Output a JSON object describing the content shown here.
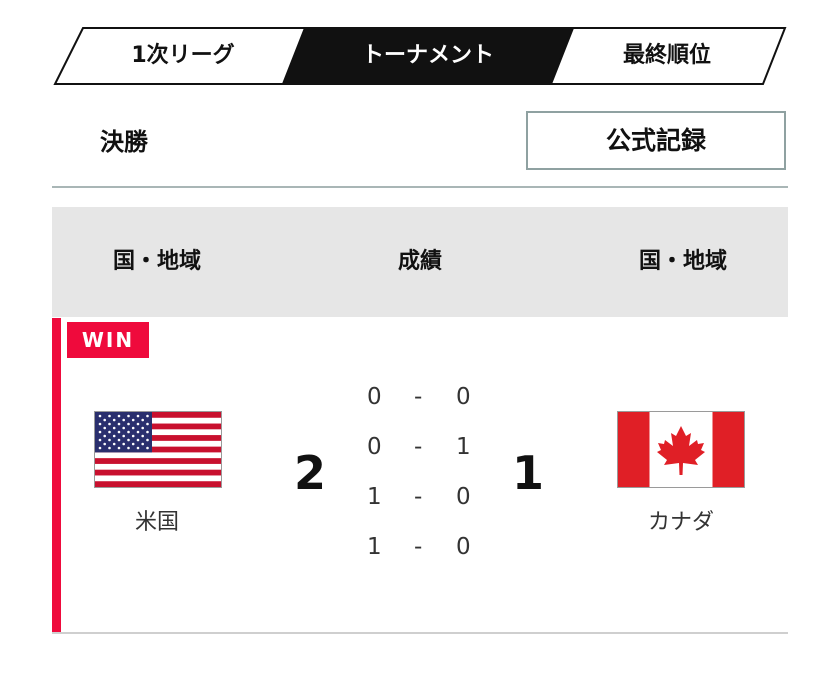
{
  "tabs": [
    {
      "label": "1次リーグ",
      "active": false
    },
    {
      "label": "トーナメント",
      "active": true
    },
    {
      "label": "最終順位",
      "active": false
    }
  ],
  "round": {
    "title": "決勝",
    "record_button": "公式記録"
  },
  "table_header": {
    "home": "国・地域",
    "score": "成績",
    "away": "国・地域"
  },
  "match": {
    "badge": "WIN",
    "home": {
      "name": "米国",
      "score": "2",
      "flag_icon": "us-flag-icon"
    },
    "away": {
      "name": "カナダ",
      "score": "1",
      "flag_icon": "canada-flag-icon"
    },
    "periods": [
      {
        "home": "0",
        "sep": "-",
        "away": "0"
      },
      {
        "home": "0",
        "sep": "-",
        "away": "1"
      },
      {
        "home": "1",
        "sep": "-",
        "away": "0"
      },
      {
        "home": "1",
        "sep": "-",
        "away": "0"
      }
    ]
  },
  "colors": {
    "accent": "#ef0a3c",
    "tab_active_bg": "#111111",
    "header_bg": "#e6e6e6"
  }
}
